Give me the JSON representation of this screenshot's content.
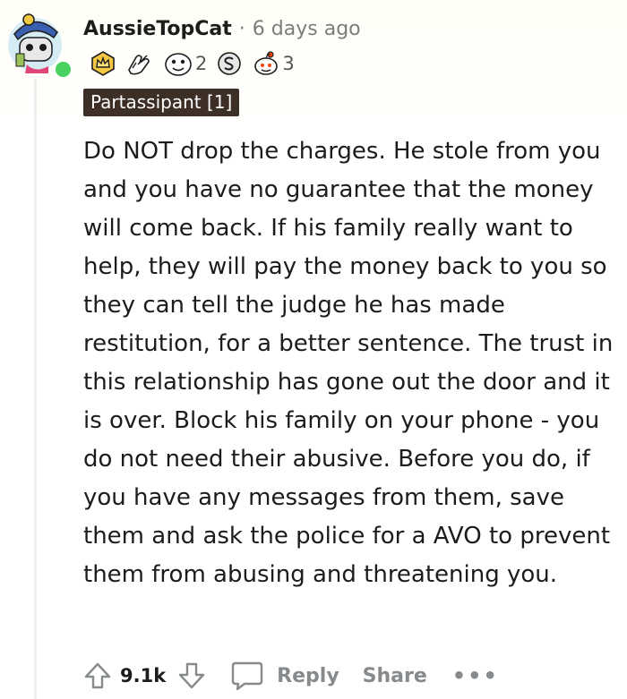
{
  "comment": {
    "username": "AussieTopCat",
    "separator": "·",
    "timestamp": "6 days ago",
    "flair": "Partassipant [1]",
    "body": "Do NOT drop the charges. He stole from you and you have no guarantee that the money will come back. If his family really want to help, they will pay the money back to you so they can tell the judge he has made restitution, for a better sentence. The trust in this relationship has gone out the door and it is over. Block his family on your phone - you do not need their abusive. Before you do, if you have any messages from them, save them and ask the police for a AVO to prevent them from abusing and threatening you."
  },
  "awards": [
    {
      "icon": "crown-award-icon",
      "count": null
    },
    {
      "icon": "hands-award-icon",
      "count": null
    },
    {
      "icon": "face-award-icon",
      "count": "2"
    },
    {
      "icon": "silver-s-award-icon",
      "count": null
    },
    {
      "icon": "snoo-award-icon",
      "count": "3"
    }
  ],
  "actions": {
    "vote_count": "9.1k",
    "reply_label": "Reply",
    "share_label": "Share",
    "more_label": "•••"
  },
  "colors": {
    "online": "#46d160",
    "flair_bg": "#3d2e26",
    "meta_gray": "#7c7c7c",
    "action_gray": "#878a8c"
  }
}
